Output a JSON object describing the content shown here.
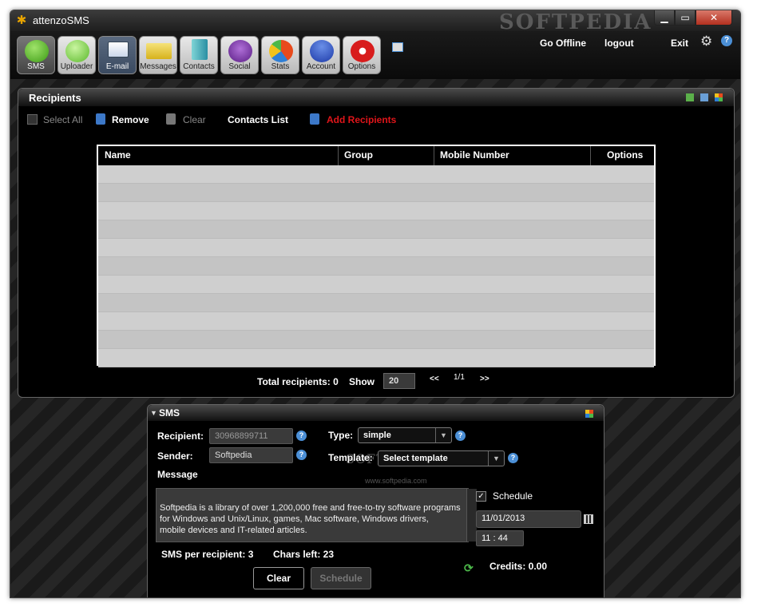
{
  "window": {
    "title": "attenzoSMS",
    "watermark": "SOFTPEDIA"
  },
  "toolbar": {
    "tools": [
      {
        "label": "SMS",
        "icon": "sms-icon"
      },
      {
        "label": "Uploader",
        "icon": "uploader-icon"
      },
      {
        "label": "E-mail",
        "icon": "email-icon"
      },
      {
        "label": "Messages",
        "icon": "messages-icon"
      },
      {
        "label": "Contacts",
        "icon": "contacts-icon"
      },
      {
        "label": "Social",
        "icon": "social-icon"
      },
      {
        "label": "Stats",
        "icon": "stats-icon"
      },
      {
        "label": "Account",
        "icon": "account-icon"
      },
      {
        "label": "Options",
        "icon": "options-icon"
      }
    ],
    "go_offline": "Go Offline",
    "logout": "logout",
    "exit": "Exit"
  },
  "recipients": {
    "title": "Recipients",
    "select_all": "Select All",
    "remove": "Remove",
    "clear": "Clear",
    "contacts_list": "Contacts List",
    "add_recipients": "Add Recipients",
    "columns": [
      "Name",
      "Group",
      "Mobile Number",
      "Options"
    ],
    "total_label": "Total recipients: 0",
    "show_label": "Show",
    "show_value": "20",
    "prev": "<<",
    "page": "1/1",
    "next": ">>"
  },
  "sms": {
    "title": "SMS",
    "recipient_label": "Recipient:",
    "recipient_value": "30968899711",
    "sender_label": "Sender:",
    "sender_value": "Softpedia",
    "type_label": "Type:",
    "type_value": "simple",
    "template_label": "Template:",
    "template_value": "Select template",
    "message_label": "Message",
    "message_text": "Softpedia is a library of over 1,200,000 free and free-to-try software programs\nfor Windows and Unix/Linux, games, Mac software, Windows drivers,\nmobile devices and IT-related articles.",
    "schedule_label": "Schedule",
    "date_value": "11/01/2013",
    "hour": "11",
    "minute": "44",
    "sms_per_recipient": "SMS per recipient: 3",
    "chars_left": "Chars left: 23",
    "credits": "Credits: 0.00",
    "clear_button": "Clear",
    "schedule_button": "Schedule",
    "watermark": "SOFTPEDIA",
    "watermark_url": "www.softpedia.com"
  }
}
